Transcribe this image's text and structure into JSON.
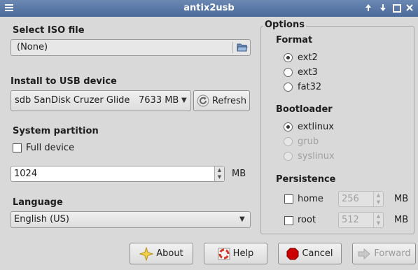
{
  "window": {
    "title": "antix2usb"
  },
  "iso": {
    "heading": "Select ISO file",
    "value": "(None)"
  },
  "usb": {
    "heading": "Install to USB device",
    "device": "sdb SanDisk Cruzer Glide",
    "size": "7633 MB",
    "refresh_label": "Refresh"
  },
  "partition": {
    "heading": "System partition",
    "full_device_label": "Full device",
    "size_value": "1024",
    "unit": "MB"
  },
  "language": {
    "heading": "Language",
    "selected": "English (US)"
  },
  "options": {
    "heading": "Options",
    "format": {
      "heading": "Format",
      "items": [
        {
          "label": "ext2",
          "checked": true
        },
        {
          "label": "ext3",
          "checked": false
        },
        {
          "label": "fat32",
          "checked": false
        }
      ]
    },
    "bootloader": {
      "heading": "Bootloader",
      "items": [
        {
          "label": "extlinux",
          "checked": true,
          "enabled": true
        },
        {
          "label": "grub",
          "checked": false,
          "enabled": false
        },
        {
          "label": "syslinux",
          "checked": false,
          "enabled": false
        }
      ]
    },
    "persistence": {
      "heading": "Persistence",
      "home": {
        "label": "home",
        "value": "256",
        "unit": "MB"
      },
      "root": {
        "label": "root",
        "value": "512",
        "unit": "MB"
      }
    }
  },
  "buttons": {
    "about": "About",
    "help": "Help",
    "cancel": "Cancel",
    "forward": "Forward"
  },
  "colors": {
    "titlebar": "#5a78a6",
    "cancel_icon": "#cc0000",
    "about_icon": "#f3d34a"
  }
}
